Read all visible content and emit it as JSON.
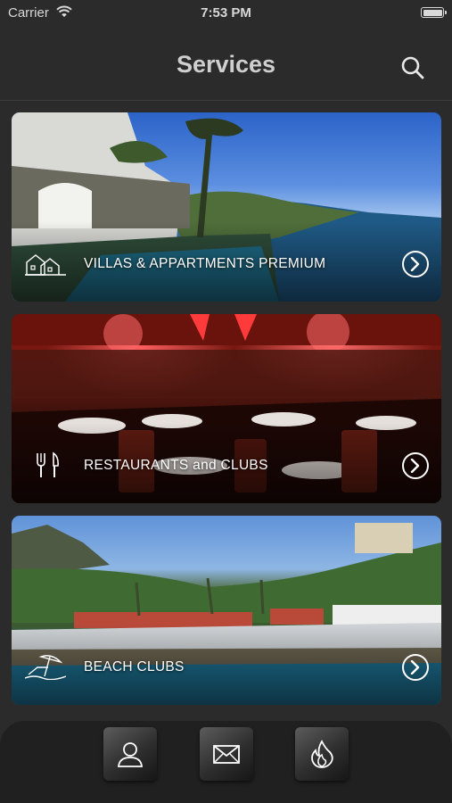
{
  "status_bar": {
    "carrier": "Carrier",
    "time": "7:53 PM",
    "icons": [
      "wifi-icon",
      "battery-icon"
    ]
  },
  "header": {
    "title": "Services",
    "search_icon": "search-icon"
  },
  "services": [
    {
      "label": "VILLAS & APPARTMENTS PREMIUM",
      "icon": "house-icon"
    },
    {
      "label": "RESTAURANTS and CLUBS",
      "icon": "fork-knife-icon"
    },
    {
      "label": "BEACH CLUBS",
      "icon": "beach-icon"
    }
  ],
  "tab_bar": {
    "items": [
      {
        "icon": "user-icon"
      },
      {
        "icon": "mail-icon"
      },
      {
        "icon": "flame-icon"
      }
    ]
  },
  "colors": {
    "background": "#2b2b2b",
    "tab_bar": "#202020",
    "title": "#cfcfcf"
  }
}
